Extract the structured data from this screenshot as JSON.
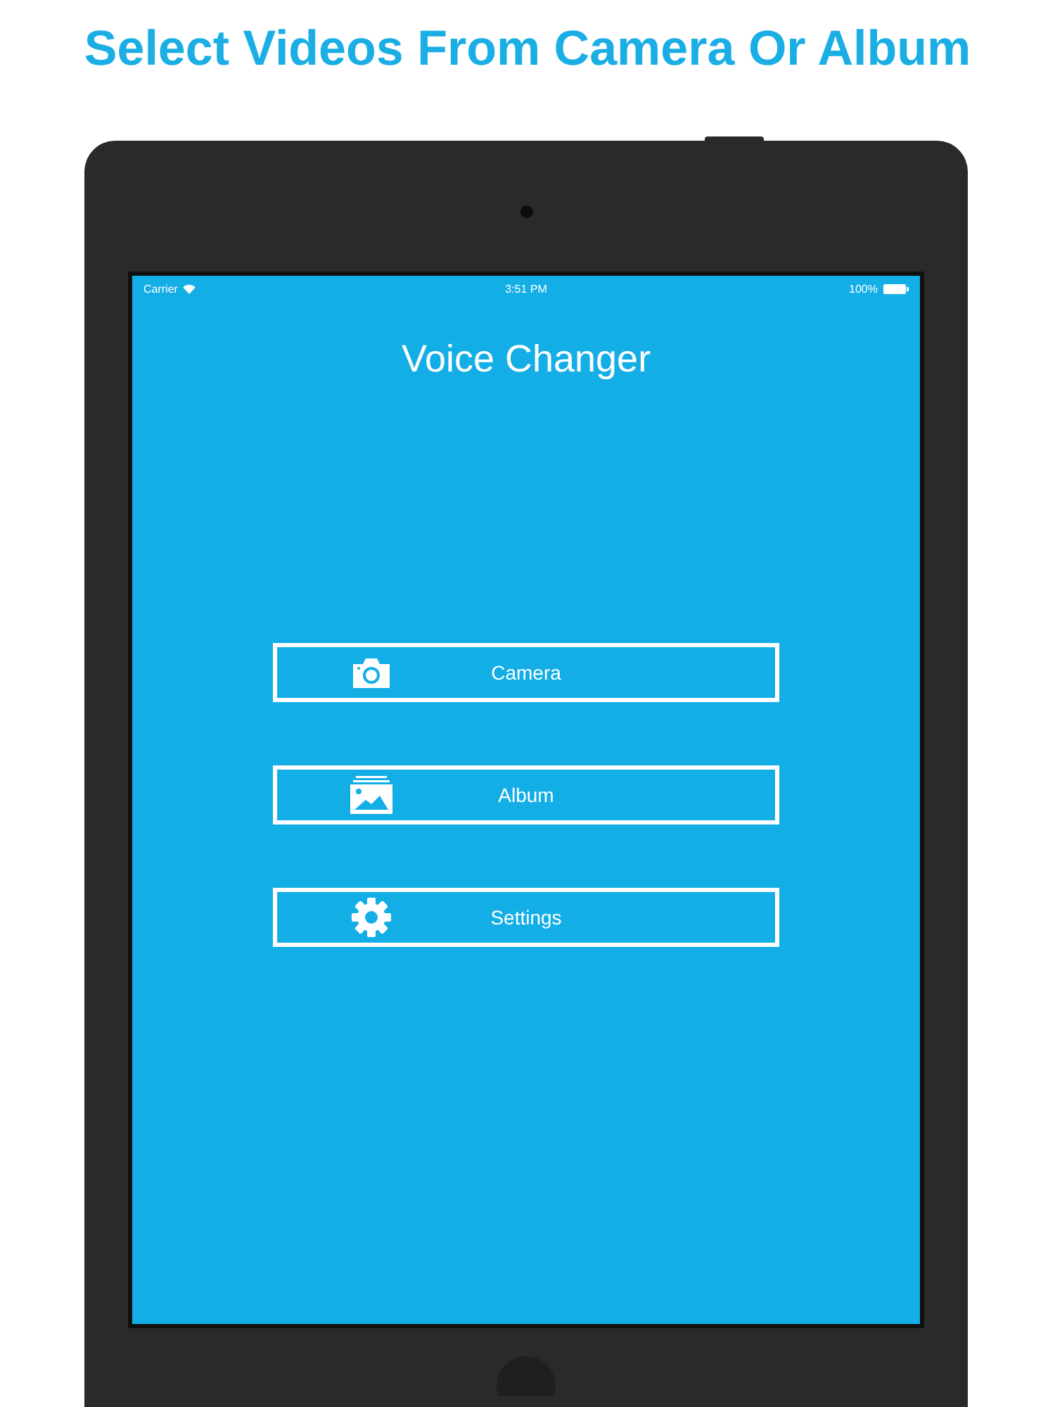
{
  "headline": "Select Videos From Camera Or Album",
  "status_bar": {
    "carrier": "Carrier",
    "time": "3:51 PM",
    "battery": "100%"
  },
  "screen_title": "Voice Changer",
  "buttons": [
    {
      "label": "Camera",
      "kind": "camera"
    },
    {
      "label": "Album",
      "kind": "album"
    },
    {
      "label": "Settings",
      "kind": "settings"
    }
  ]
}
